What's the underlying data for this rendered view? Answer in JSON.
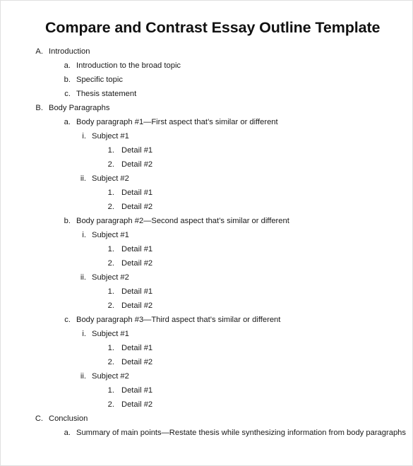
{
  "document": {
    "title": "Compare and Contrast Essay Outline Template"
  },
  "outline": [
    {
      "marker": "A.",
      "level": 1,
      "label": "Introduction"
    },
    {
      "marker": "a.",
      "level": 2,
      "label": "Introduction to the broad topic"
    },
    {
      "marker": "b.",
      "level": 2,
      "label": "Specific topic"
    },
    {
      "marker": "c.",
      "level": 2,
      "label": "Thesis statement"
    },
    {
      "marker": "B.",
      "level": 1,
      "label": "Body Paragraphs"
    },
    {
      "marker": "a.",
      "level": 2,
      "label": "Body paragraph #1—First aspect that’s similar or different"
    },
    {
      "marker": "i.",
      "level": 3,
      "label": "Subject #1"
    },
    {
      "marker": "1.",
      "level": 4,
      "label": "Detail #1"
    },
    {
      "marker": "2.",
      "level": 4,
      "label": "Detail #2"
    },
    {
      "marker": "ii.",
      "level": 3,
      "label": "Subject #2"
    },
    {
      "marker": "1.",
      "level": 4,
      "label": "Detail #1"
    },
    {
      "marker": "2.",
      "level": 4,
      "label": "Detail #2"
    },
    {
      "marker": "b.",
      "level": 2,
      "label": "Body paragraph #2—Second aspect that’s similar or different"
    },
    {
      "marker": "i.",
      "level": 3,
      "label": "Subject #1"
    },
    {
      "marker": "1.",
      "level": 4,
      "label": "Detail #1"
    },
    {
      "marker": "2.",
      "level": 4,
      "label": "Detail #2"
    },
    {
      "marker": "ii.",
      "level": 3,
      "label": "Subject #2"
    },
    {
      "marker": "1.",
      "level": 4,
      "label": "Detail #1"
    },
    {
      "marker": "2.",
      "level": 4,
      "label": "Detail #2"
    },
    {
      "marker": "c.",
      "level": 2,
      "label": "Body paragraph #3—Third aspect that’s similar or different"
    },
    {
      "marker": "i.",
      "level": 3,
      "label": "Subject #1"
    },
    {
      "marker": "1.",
      "level": 4,
      "label": "Detail #1"
    },
    {
      "marker": "2.",
      "level": 4,
      "label": "Detail #2"
    },
    {
      "marker": "ii.",
      "level": 3,
      "label": "Subject #2"
    },
    {
      "marker": "1.",
      "level": 4,
      "label": "Detail #1"
    },
    {
      "marker": "2.",
      "level": 4,
      "label": "Detail #2"
    },
    {
      "marker": "C.",
      "level": 1,
      "label": "Conclusion"
    },
    {
      "marker": "a.",
      "level": 2,
      "label": "Summary of main points—Restate thesis while synthesizing information from body paragraphs"
    }
  ]
}
